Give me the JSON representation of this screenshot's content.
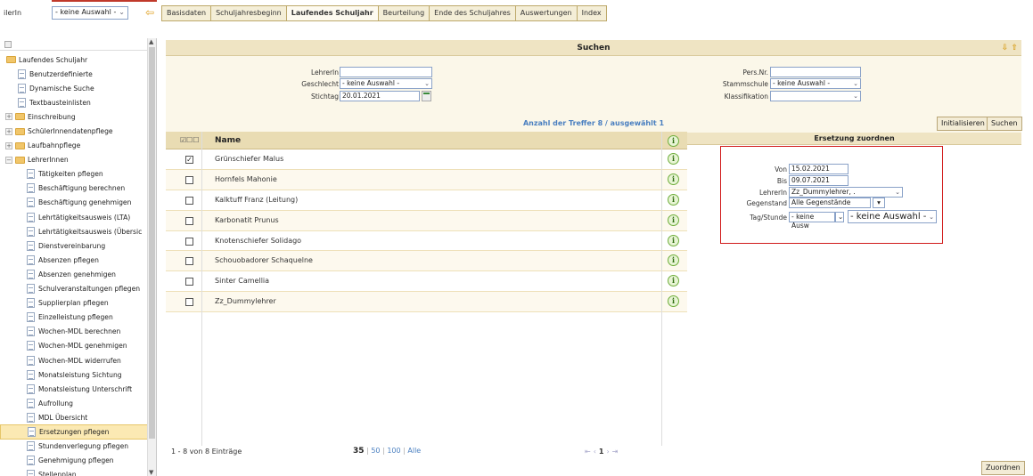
{
  "topbar": {
    "left_label": "ilerIn",
    "select_value": "- keine Auswahl -",
    "tabs": [
      "Basisdaten",
      "Schuljahresbeginn",
      "Laufendes Schuljahr",
      "Beurteilung",
      "Ende des Schuljahres",
      "Auswertungen",
      "Index"
    ],
    "active_tab": "Laufendes Schuljahr"
  },
  "sidebar": {
    "root": "Laufendes Schuljahr",
    "items": [
      {
        "label": "Laufendes Schuljahr",
        "kind": "folder-open",
        "level": 0
      },
      {
        "label": "Benutzerdefinierte",
        "kind": "doc",
        "level": 1
      },
      {
        "label": "Dynamische Suche",
        "kind": "doc",
        "level": 1
      },
      {
        "label": "Textbausteinlisten",
        "kind": "doc",
        "level": 1
      },
      {
        "label": "Einschreibung",
        "kind": "folder",
        "level": 0,
        "exp": "+"
      },
      {
        "label": "SchülerInnendatenpflege",
        "kind": "folder",
        "level": 0,
        "exp": "+"
      },
      {
        "label": "Laufbahnpflege",
        "kind": "folder",
        "level": 0,
        "exp": "+"
      },
      {
        "label": "LehrerInnen",
        "kind": "folder-open",
        "level": 0,
        "exp": "−"
      },
      {
        "label": "Tätigkeiten pflegen",
        "kind": "doc",
        "level": 2
      },
      {
        "label": "Beschäftigung berechnen",
        "kind": "doc",
        "level": 2
      },
      {
        "label": "Beschäftigung genehmigen",
        "kind": "doc",
        "level": 2
      },
      {
        "label": "Lehrtätigkeitsausweis (LTA)",
        "kind": "doc",
        "level": 2
      },
      {
        "label": "Lehrtätigkeitsausweis (Übersic",
        "kind": "doc",
        "level": 2
      },
      {
        "label": "Dienstvereinbarung",
        "kind": "doc",
        "level": 2
      },
      {
        "label": "Absenzen pflegen",
        "kind": "doc",
        "level": 2
      },
      {
        "label": "Absenzen genehmigen",
        "kind": "doc",
        "level": 2
      },
      {
        "label": "Schulveranstaltungen pflegen",
        "kind": "doc",
        "level": 2
      },
      {
        "label": "Supplierplan pflegen",
        "kind": "doc",
        "level": 2
      },
      {
        "label": "Einzelleistung pflegen",
        "kind": "doc",
        "level": 2
      },
      {
        "label": "Wochen-MDL berechnen",
        "kind": "doc",
        "level": 2
      },
      {
        "label": "Wochen-MDL genehmigen",
        "kind": "doc",
        "level": 2
      },
      {
        "label": "Wochen-MDL widerrufen",
        "kind": "doc",
        "level": 2
      },
      {
        "label": "Monatsleistung Sichtung",
        "kind": "doc",
        "level": 2
      },
      {
        "label": "Monatsleistung Unterschrift",
        "kind": "doc",
        "level": 2
      },
      {
        "label": "Aufrollung",
        "kind": "doc",
        "level": 2
      },
      {
        "label": "MDL Übersicht",
        "kind": "doc",
        "level": 2
      },
      {
        "label": "Ersetzungen pflegen",
        "kind": "doc",
        "level": 2,
        "selected": true
      },
      {
        "label": "Stundenverlegung pflegen",
        "kind": "doc",
        "level": 2
      },
      {
        "label": "Genehmigung pflegen",
        "kind": "doc",
        "level": 2
      },
      {
        "label": "Stellenplan",
        "kind": "doc",
        "level": 2
      }
    ]
  },
  "search": {
    "title": "Suchen",
    "lehrerin_label": "LehrerIn",
    "lehrerin_value": "",
    "geschlecht_label": "Geschlecht",
    "geschlecht_value": "- keine Auswahl -",
    "stichtag_label": "Stichtag",
    "stichtag_value": "20.01.2021",
    "persnr_label": "Pers.Nr.",
    "persnr_value": "",
    "stammschule_label": "Stammschule",
    "stammschule_value": "- keine Auswahl -",
    "klassifikation_label": "Klassifikation",
    "klassifikation_value": "",
    "hits_text": "Anzahl der Treffer  8 / ausgewählt  1",
    "init_button": "Initialisieren",
    "search_button": "Suchen"
  },
  "table": {
    "name_header": "Name",
    "rows": [
      {
        "name": "Grünschiefer Malus",
        "checked": true
      },
      {
        "name": "Hornfels Mahonie",
        "checked": false
      },
      {
        "name": "Kalktuff Franz (Leitung)",
        "checked": false
      },
      {
        "name": "Karbonatit Prunus",
        "checked": false
      },
      {
        "name": "Knotenschiefer Solidago",
        "checked": false
      },
      {
        "name": "Schouobadorer Schaquelne",
        "checked": false
      },
      {
        "name": "Sinter Camellia",
        "checked": false
      },
      {
        "name": "Zz_Dummylehrer",
        "checked": false
      }
    ],
    "footer_count": "1 - 8 von 8 Einträge",
    "page_sizes": {
      "current": "35",
      "s50": "50",
      "s100": "100",
      "all": "Alle"
    },
    "current_page": "1"
  },
  "assign": {
    "title": "Ersetzung zuordnen",
    "von_label": "Von",
    "von_value": "15.02.2021",
    "bis_label": "Bis",
    "bis_value": "09.07.2021",
    "lehrerin_label": "LehrerIn",
    "lehrerin_value": "Zz_Dummylehrer, .",
    "gegenstand_label": "Gegenstand",
    "gegenstand_value": "Alle Gegenstände",
    "tagstunde_label": "Tag/Stunde",
    "tag_value": "- keine Ausw",
    "stunde_value": "- keine Auswahl -",
    "assign_button": "Zuordnen"
  }
}
